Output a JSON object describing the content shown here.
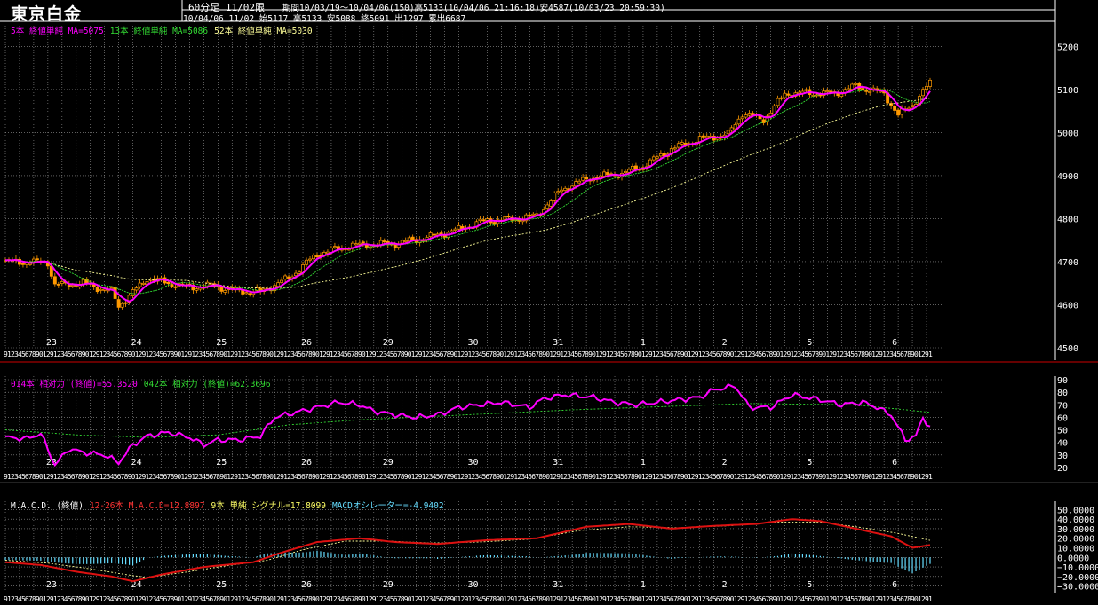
{
  "header": {
    "title": "東京白金",
    "timeframe": "60分足 11/02限",
    "period_info": "期間10/03/19〜10/04/06(150)高5133(10/04/06 21:16:18)安4587(10/03/23 20:59:30)",
    "quote_info": "10/04/06 11/02 始5117 高5133 安5088 終5091 出1297 累出6687"
  },
  "colors": {
    "background": "#000000",
    "grid": "#9a9a9a",
    "frame": "#ffffff",
    "separator": "#cc0000",
    "candle": "#ff9900",
    "ma5": "#ff00ff",
    "ma13": "#33dd33",
    "ma52": "#ffff99",
    "rsi14": "#ff00ff",
    "rsi42": "#33dd33",
    "macd": "#dd1111",
    "signal": "#ffff99",
    "oscillator": "#66ddff"
  },
  "price_panel": {
    "legend": [
      {
        "text": "5本 終値単純 MA=5075",
        "color": "#ff00ff"
      },
      {
        "text": "13本 終値単純 MA=5086",
        "color": "#33dd33"
      },
      {
        "text": "52本 終値単純 MA=5030",
        "color": "#ffff99"
      }
    ]
  },
  "rsi_panel": {
    "legend": [
      {
        "text": "014本 相対力 (終値)=55.3520",
        "color": "#ff00ff"
      },
      {
        "text": "042本 相対力 (終値)=62.3696",
        "color": "#33dd33"
      }
    ]
  },
  "macd_panel": {
    "legend": [
      {
        "text": "M.A.C.D. (終値)",
        "color": "#ffffff"
      },
      {
        "text": "12-26本 M.A.C.D=12.8897",
        "color": "#ff3333"
      },
      {
        "text": "9本 単純 シグナル=17.8099",
        "color": "#ffff66"
      },
      {
        "text": "MACDオシレーター=-4.9402",
        "color": "#66ddff"
      }
    ]
  },
  "x_axis": {
    "hour_labels": [
      "19",
      "1",
      "2",
      "3",
      "4",
      "5",
      "6",
      "7",
      "8",
      "9",
      "10",
      "11",
      "12"
    ],
    "day_labels": [
      {
        "label": "23",
        "at": 13
      },
      {
        "label": "24",
        "at": 36
      },
      {
        "label": "25",
        "at": 59
      },
      {
        "label": "26",
        "at": 82
      },
      {
        "label": "29",
        "at": 105
      },
      {
        "label": "30",
        "at": 128
      },
      {
        "label": "31",
        "at": 151
      },
      {
        "label": "1",
        "at": 174
      },
      {
        "label": "2",
        "at": 197
      },
      {
        "label": "5",
        "at": 220
      },
      {
        "label": "6",
        "at": 243
      }
    ]
  },
  "chart_data": [
    {
      "type": "candlestick",
      "title": "",
      "ylim": [
        4500,
        5240
      ],
      "yticks": [
        4500,
        4600,
        4700,
        4800,
        4900,
        5000,
        5100,
        5200
      ],
      "bar_count": 262,
      "price_keyframes": [
        [
          0,
          4700
        ],
        [
          12,
          4698
        ],
        [
          14,
          4645
        ],
        [
          22,
          4650
        ],
        [
          30,
          4630
        ],
        [
          32,
          4598
        ],
        [
          35,
          4620
        ],
        [
          40,
          4662
        ],
        [
          46,
          4650
        ],
        [
          52,
          4640
        ],
        [
          58,
          4645
        ],
        [
          65,
          4632
        ],
        [
          72,
          4630
        ],
        [
          80,
          4662
        ],
        [
          88,
          4718
        ],
        [
          98,
          4738
        ],
        [
          110,
          4742
        ],
        [
          120,
          4758
        ],
        [
          128,
          4775
        ],
        [
          135,
          4795
        ],
        [
          145,
          4800
        ],
        [
          150,
          4808
        ],
        [
          157,
          4868
        ],
        [
          165,
          4895
        ],
        [
          174,
          4905
        ],
        [
          180,
          4922
        ],
        [
          188,
          4962
        ],
        [
          196,
          4985
        ],
        [
          204,
          4996
        ],
        [
          208,
          5045
        ],
        [
          214,
          5030
        ],
        [
          220,
          5090
        ],
        [
          226,
          5092
        ],
        [
          234,
          5090
        ],
        [
          240,
          5108
        ],
        [
          248,
          5090
        ],
        [
          252,
          5040
        ],
        [
          256,
          5065
        ],
        [
          261,
          5115
        ]
      ],
      "series": [
        {
          "name": "5本 終値単純 MA",
          "last": 5075
        },
        {
          "name": "13本 終値単純 MA",
          "last": 5086
        },
        {
          "name": "52本 終値単純 MA",
          "last": 5030
        }
      ]
    },
    {
      "type": "line",
      "title": "",
      "ylim": [
        20,
        90
      ],
      "yticks": [
        20,
        30,
        40,
        50,
        60,
        70,
        80,
        90
      ],
      "series": [
        {
          "name": "014本 相対力 (終値)",
          "last": 55.352,
          "keyframes": [
            [
              0,
              44
            ],
            [
              6,
              43
            ],
            [
              10,
              47
            ],
            [
              14,
              22
            ],
            [
              18,
              35
            ],
            [
              22,
              32
            ],
            [
              28,
              30
            ],
            [
              32,
              24
            ],
            [
              36,
              38
            ],
            [
              40,
              45
            ],
            [
              46,
              48
            ],
            [
              52,
              44
            ],
            [
              56,
              38
            ],
            [
              60,
              42
            ],
            [
              66,
              42
            ],
            [
              72,
              45
            ],
            [
              76,
              60
            ],
            [
              82,
              64
            ],
            [
              88,
              68
            ],
            [
              94,
              72
            ],
            [
              100,
              70
            ],
            [
              104,
              65
            ],
            [
              110,
              62
            ],
            [
              116,
              60
            ],
            [
              122,
              62
            ],
            [
              128,
              68
            ],
            [
              134,
              70
            ],
            [
              140,
              72
            ],
            [
              148,
              68
            ],
            [
              152,
              75
            ],
            [
              158,
              78
            ],
            [
              166,
              76
            ],
            [
              172,
              72
            ],
            [
              178,
              70
            ],
            [
              184,
              72
            ],
            [
              190,
              74
            ],
            [
              196,
              76
            ],
            [
              200,
              82
            ],
            [
              206,
              85
            ],
            [
              210,
              68
            ],
            [
              216,
              68
            ],
            [
              222,
              78
            ],
            [
              230,
              74
            ],
            [
              236,
              70
            ],
            [
              242,
              72
            ],
            [
              246,
              68
            ],
            [
              250,
              62
            ],
            [
              254,
              42
            ],
            [
              257,
              45
            ],
            [
              259,
              60
            ],
            [
              261,
              52
            ]
          ]
        },
        {
          "name": "042本 相対力 (終値)",
          "last": 62.3696,
          "keyframes": [
            [
              0,
              50
            ],
            [
              20,
              46
            ],
            [
              40,
              44
            ],
            [
              60,
              46
            ],
            [
              80,
              54
            ],
            [
              100,
              58
            ],
            [
              130,
              62
            ],
            [
              160,
              66
            ],
            [
              190,
              69
            ],
            [
              210,
              71
            ],
            [
              240,
              70
            ],
            [
              261,
              64
            ]
          ]
        }
      ]
    },
    {
      "type": "line",
      "title": "",
      "ylim": [
        -35,
        55
      ],
      "yticks": [
        -30,
        -20,
        -10,
        0,
        10,
        20,
        30,
        40,
        50
      ],
      "series": [
        {
          "name": "12-26本 M.A.C.D",
          "last": 12.8897,
          "keyframes": [
            [
              0,
              -5
            ],
            [
              10,
              -8
            ],
            [
              20,
              -15
            ],
            [
              30,
              -20
            ],
            [
              36,
              -25
            ],
            [
              44,
              -18
            ],
            [
              56,
              -10
            ],
            [
              70,
              -5
            ],
            [
              78,
              5
            ],
            [
              88,
              16
            ],
            [
              100,
              20
            ],
            [
              110,
              16
            ],
            [
              122,
              14
            ],
            [
              136,
              18
            ],
            [
              150,
              20
            ],
            [
              164,
              32
            ],
            [
              176,
              35
            ],
            [
              188,
              30
            ],
            [
              200,
              33
            ],
            [
              212,
              35
            ],
            [
              222,
              40
            ],
            [
              230,
              38
            ],
            [
              240,
              30
            ],
            [
              250,
              22
            ],
            [
              256,
              10
            ],
            [
              261,
              12.9
            ]
          ]
        },
        {
          "name": "9本 単純 シグナル",
          "last": 17.8099,
          "keyframes": [
            [
              0,
              -3
            ],
            [
              12,
              -6
            ],
            [
              24,
              -12
            ],
            [
              34,
              -18
            ],
            [
              40,
              -21
            ],
            [
              50,
              -16
            ],
            [
              62,
              -9
            ],
            [
              74,
              -3
            ],
            [
              84,
              8
            ],
            [
              96,
              17
            ],
            [
              108,
              17
            ],
            [
              120,
              15
            ],
            [
              134,
              16
            ],
            [
              148,
              19
            ],
            [
              162,
              28
            ],
            [
              176,
              32
            ],
            [
              190,
              31
            ],
            [
              204,
              33
            ],
            [
              218,
              37
            ],
            [
              230,
              37
            ],
            [
              242,
              31
            ],
            [
              252,
              25
            ],
            [
              261,
              17.8
            ]
          ]
        },
        {
          "name": "MACDオシレーター",
          "last": -4.9402
        }
      ]
    }
  ]
}
